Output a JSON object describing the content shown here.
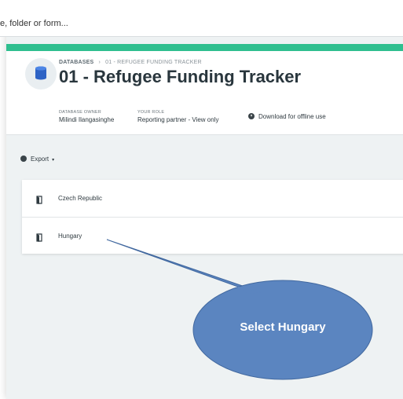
{
  "search": {
    "text": "e, folder or form..."
  },
  "breadcrumb": {
    "root": "DATABASES",
    "separator": "›",
    "current": "01 - REFUGEE FUNDING TRACKER"
  },
  "page": {
    "title": "01 - Refugee Funding Tracker"
  },
  "meta": {
    "owner_label": "DATABASE OWNER",
    "owner_value": "Milindi Ilangasinghe",
    "role_label": "YOUR ROLE",
    "role_value": "Reporting partner - View only",
    "download_label": "Download for offline use"
  },
  "toolbar": {
    "export_label": "Export",
    "export_caret": "▾"
  },
  "folders": [
    {
      "label": "Czech Republic",
      "icon": "folder-icon"
    },
    {
      "label": "Hungary",
      "icon": "folder-icon"
    }
  ],
  "callout": {
    "text": "Select Hungary"
  },
  "colors": {
    "accent": "#2fbf8f",
    "callout_fill": "#5b85c0",
    "database_icon": "#2e63c5"
  }
}
